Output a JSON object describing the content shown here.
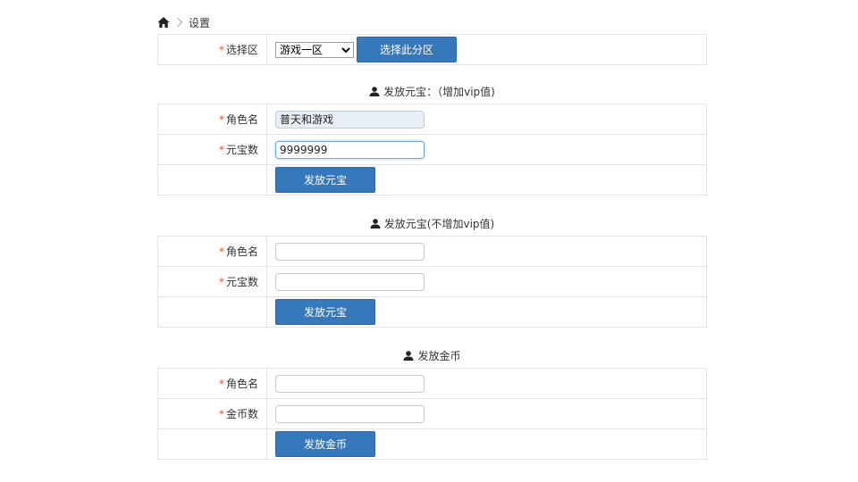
{
  "breadcrumb": {
    "home_icon": "home-icon",
    "separator_icon": "chevron-right-icon",
    "current": "设置"
  },
  "zone_select": {
    "label_required": "*",
    "label": "选择区",
    "selected": "游戏一区",
    "options": [
      "游戏一区"
    ],
    "button_label": "选择此分区"
  },
  "section1": {
    "icon": "user-icon",
    "title": "发放元宝：（增加vip值)",
    "name_label": "角色名",
    "name_value": "普天和游戏",
    "amount_label": "元宝数",
    "amount_value": "9999999",
    "submit_label": "发放元宝"
  },
  "section2": {
    "icon": "user-icon",
    "title": "发放元宝(不增加vip值)",
    "name_label": "角色名",
    "name_value": "",
    "amount_label": "元宝数",
    "amount_value": "",
    "submit_label": "发放元宝"
  },
  "section3": {
    "icon": "user-icon",
    "title": "发放金币",
    "name_label": "角色名",
    "name_value": "",
    "amount_label": "金币数",
    "amount_value": "",
    "submit_label": "发放金币"
  },
  "colors": {
    "button_bg": "#3579bc",
    "required_star": "#e8542b",
    "border": "#e4e4e4"
  }
}
